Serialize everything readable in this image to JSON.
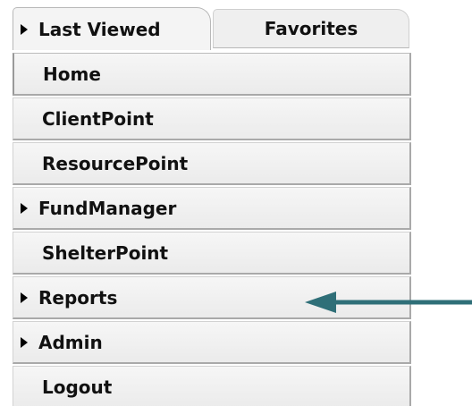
{
  "tabs": [
    {
      "label": "Last Viewed",
      "active": true,
      "expandable": true
    },
    {
      "label": "Favorites",
      "active": false,
      "expandable": false
    }
  ],
  "menu": {
    "items": [
      {
        "label": "Home",
        "expandable": false
      },
      {
        "label": "ClientPoint",
        "expandable": false
      },
      {
        "label": "ResourcePoint",
        "expandable": false
      },
      {
        "label": "FundManager",
        "expandable": true
      },
      {
        "label": "ShelterPoint",
        "expandable": false
      },
      {
        "label": "Reports",
        "expandable": true
      },
      {
        "label": "Admin",
        "expandable": true
      },
      {
        "label": "Logout",
        "expandable": false
      }
    ]
  },
  "annotation": {
    "arrow_color": "#2f6f78",
    "points_to": "Reports"
  },
  "icons": {
    "expand": "triangle-right-icon"
  }
}
